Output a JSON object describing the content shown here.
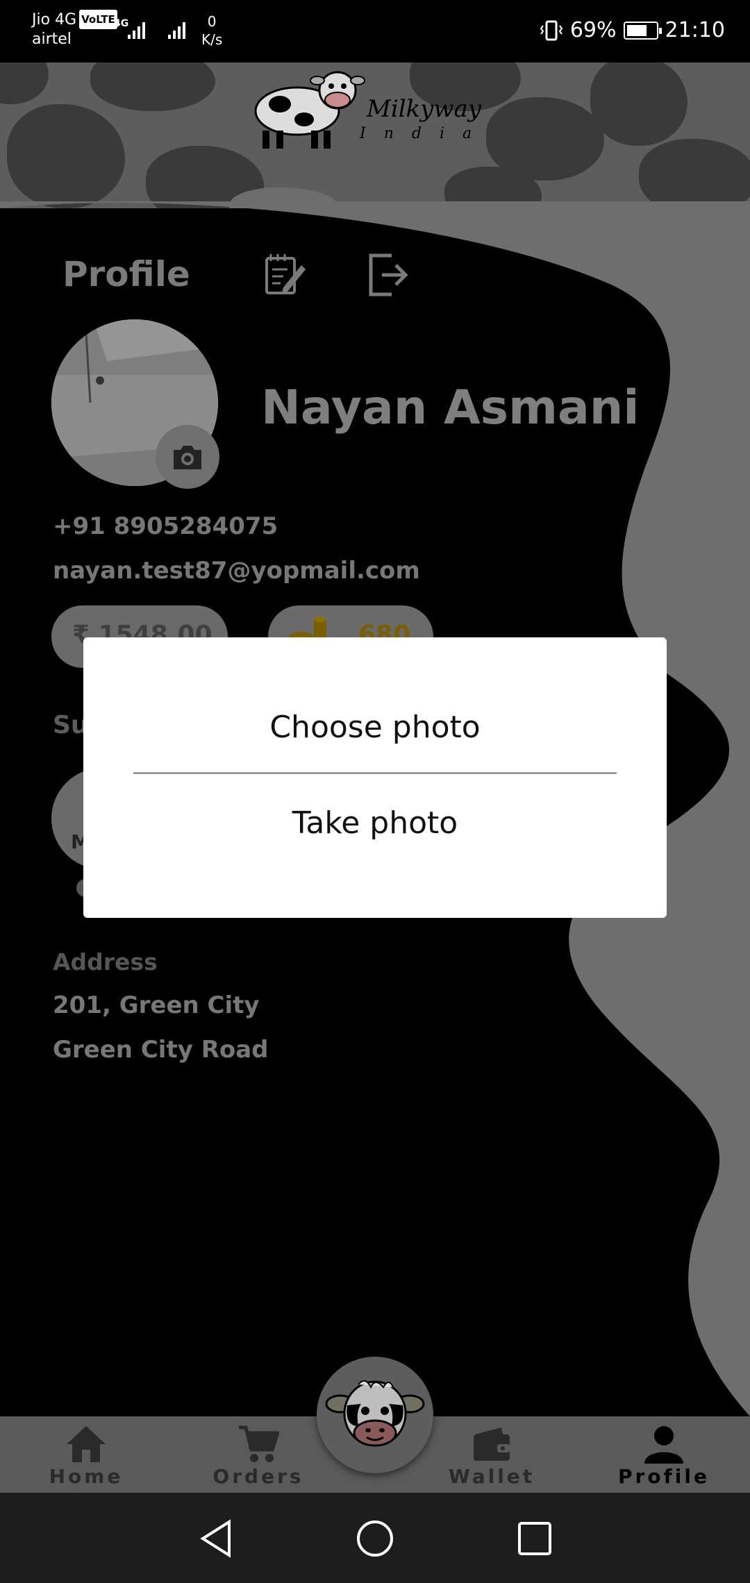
{
  "status_bar": {
    "carrier_top": "Jio 4G",
    "volte": "VoLTE",
    "carrier_bottom": "airtel",
    "net_type": "4G",
    "speed_value": "0",
    "speed_unit": "K/s",
    "battery": "69%",
    "time": "21:10"
  },
  "header": {
    "logo_title": "Milkyway",
    "logo_subtitle": "India"
  },
  "profile": {
    "section_title": "Profile",
    "name": "Nayan Asmani",
    "phone": "+91 8905284075",
    "email": "nayan.test87@yopmail.com",
    "wallet_balance": "₹ 1548.00",
    "coins": "680",
    "subscription_label": "Su",
    "subscription_letter": "M",
    "address_label": "Address",
    "address_line1": "201, Green City",
    "address_line2": "Green City Road"
  },
  "dialog": {
    "option_choose": "Choose photo",
    "option_take": "Take photo"
  },
  "bottom_nav": {
    "items": [
      {
        "label": "Home",
        "icon": "home-icon"
      },
      {
        "label": "Orders",
        "icon": "cart-icon"
      },
      {
        "label": "Wallet",
        "icon": "wallet-icon"
      },
      {
        "label": "Profile",
        "icon": "person-icon",
        "active": true
      }
    ]
  },
  "system_nav": {
    "buttons": [
      "back-icon",
      "home-circle-icon",
      "recents-icon"
    ]
  }
}
